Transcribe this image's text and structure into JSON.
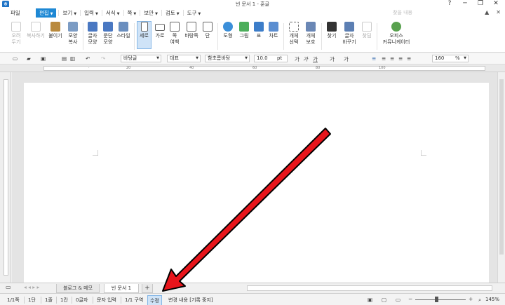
{
  "window": {
    "title": "빈 문서 1 - 훈글",
    "app_icon": "ㅎ",
    "controls": [
      "?",
      "─",
      "❐",
      "✕"
    ]
  },
  "menubar": {
    "file": "파일",
    "items": [
      "편집",
      "보기",
      "입력",
      "서식",
      "쪽",
      "보안",
      "검토",
      "도구"
    ],
    "search_placeholder": "찾을 내용",
    "right_icons": [
      "▲",
      "✕"
    ]
  },
  "ribbon": {
    "cut": [
      "오려",
      "두기"
    ],
    "copy": "복사하기",
    "paste": "붙이기",
    "shape_copy": [
      "모양",
      "복사"
    ],
    "char_shape": [
      "글자",
      "모양"
    ],
    "para_shape": [
      "문단",
      "모양"
    ],
    "style": "스타일",
    "portrait": "세로",
    "landscape": "가로",
    "page_border": [
      "쪽",
      "여백"
    ],
    "background": [
      "바탕쪽"
    ],
    "column": "단",
    "shape": "도형",
    "picture": "그림",
    "table": "표",
    "chart": "차트",
    "obj_select": [
      "개체",
      "선택"
    ],
    "obj_protect": [
      "개체",
      "보호"
    ],
    "find": "찾기",
    "replace": [
      "글자",
      "바꾸기"
    ],
    "goto": "찾딤",
    "office_community": [
      "오피스",
      "커뮤니케이터"
    ]
  },
  "formatbar": {
    "style": "바탕글",
    "lang": "대표",
    "font": "함초롬바탕",
    "size": "10.0",
    "size_unit": "pt",
    "zoom": "160",
    "zoom_unit": "%"
  },
  "tabs": {
    "memo": "블로그 & 메모",
    "doc": "빈 문서 1",
    "add": "+"
  },
  "statusbar": {
    "page": "1/1쪽",
    "column": "1단",
    "line": "1줄",
    "col": "1칸",
    "chars": "0글자",
    "input_mode": "문자 입력",
    "section": "1/1 구역",
    "edit_mode": "수정",
    "track_changes": "변경 내용 [기록 중지]",
    "zoom": "145%"
  },
  "colors": {
    "accent": "#1e88d4",
    "arrow_fill": "#e8151b",
    "arrow_outline": "#000000"
  }
}
